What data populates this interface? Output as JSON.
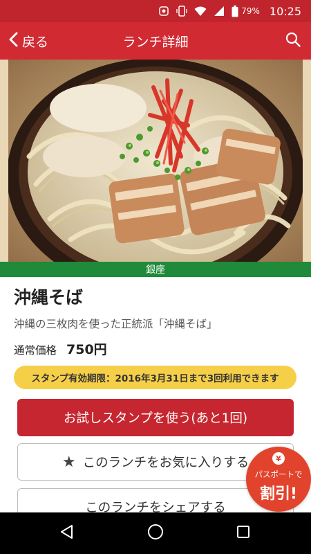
{
  "status_bar": {
    "battery_percent": "79%",
    "time": "10:25",
    "icons": [
      "notification-icon",
      "vibrate-icon",
      "wifi-icon",
      "signal-icon",
      "battery-icon"
    ]
  },
  "app_bar": {
    "back_label": "戻る",
    "title": "ランチ詳細",
    "search_icon": "search-icon"
  },
  "hero": {
    "area_label": "銀座"
  },
  "lunch": {
    "name": "沖縄そば",
    "description": "沖縄の三枚肉を使った正統派「沖縄そば」",
    "price_label": "通常価格",
    "price": "750円",
    "stamp_notice": "スタンプ有効期限：2016年3月31日まで3回利用できます"
  },
  "actions": {
    "use_stamp": "お試しスタンプを使う(あと1回)",
    "favorite": "このランチをお気に入りする",
    "share": "このランチをシェアする"
  },
  "passport_badge": {
    "yen": "¥",
    "label": "パスポートで",
    "big": "割引!"
  },
  "colors": {
    "brand_red": "#d12a33",
    "status_red": "#c0242c",
    "area_green": "#1f8a3a",
    "stamp_yellow": "#f6cf48",
    "badge_orange": "#e2432c"
  }
}
